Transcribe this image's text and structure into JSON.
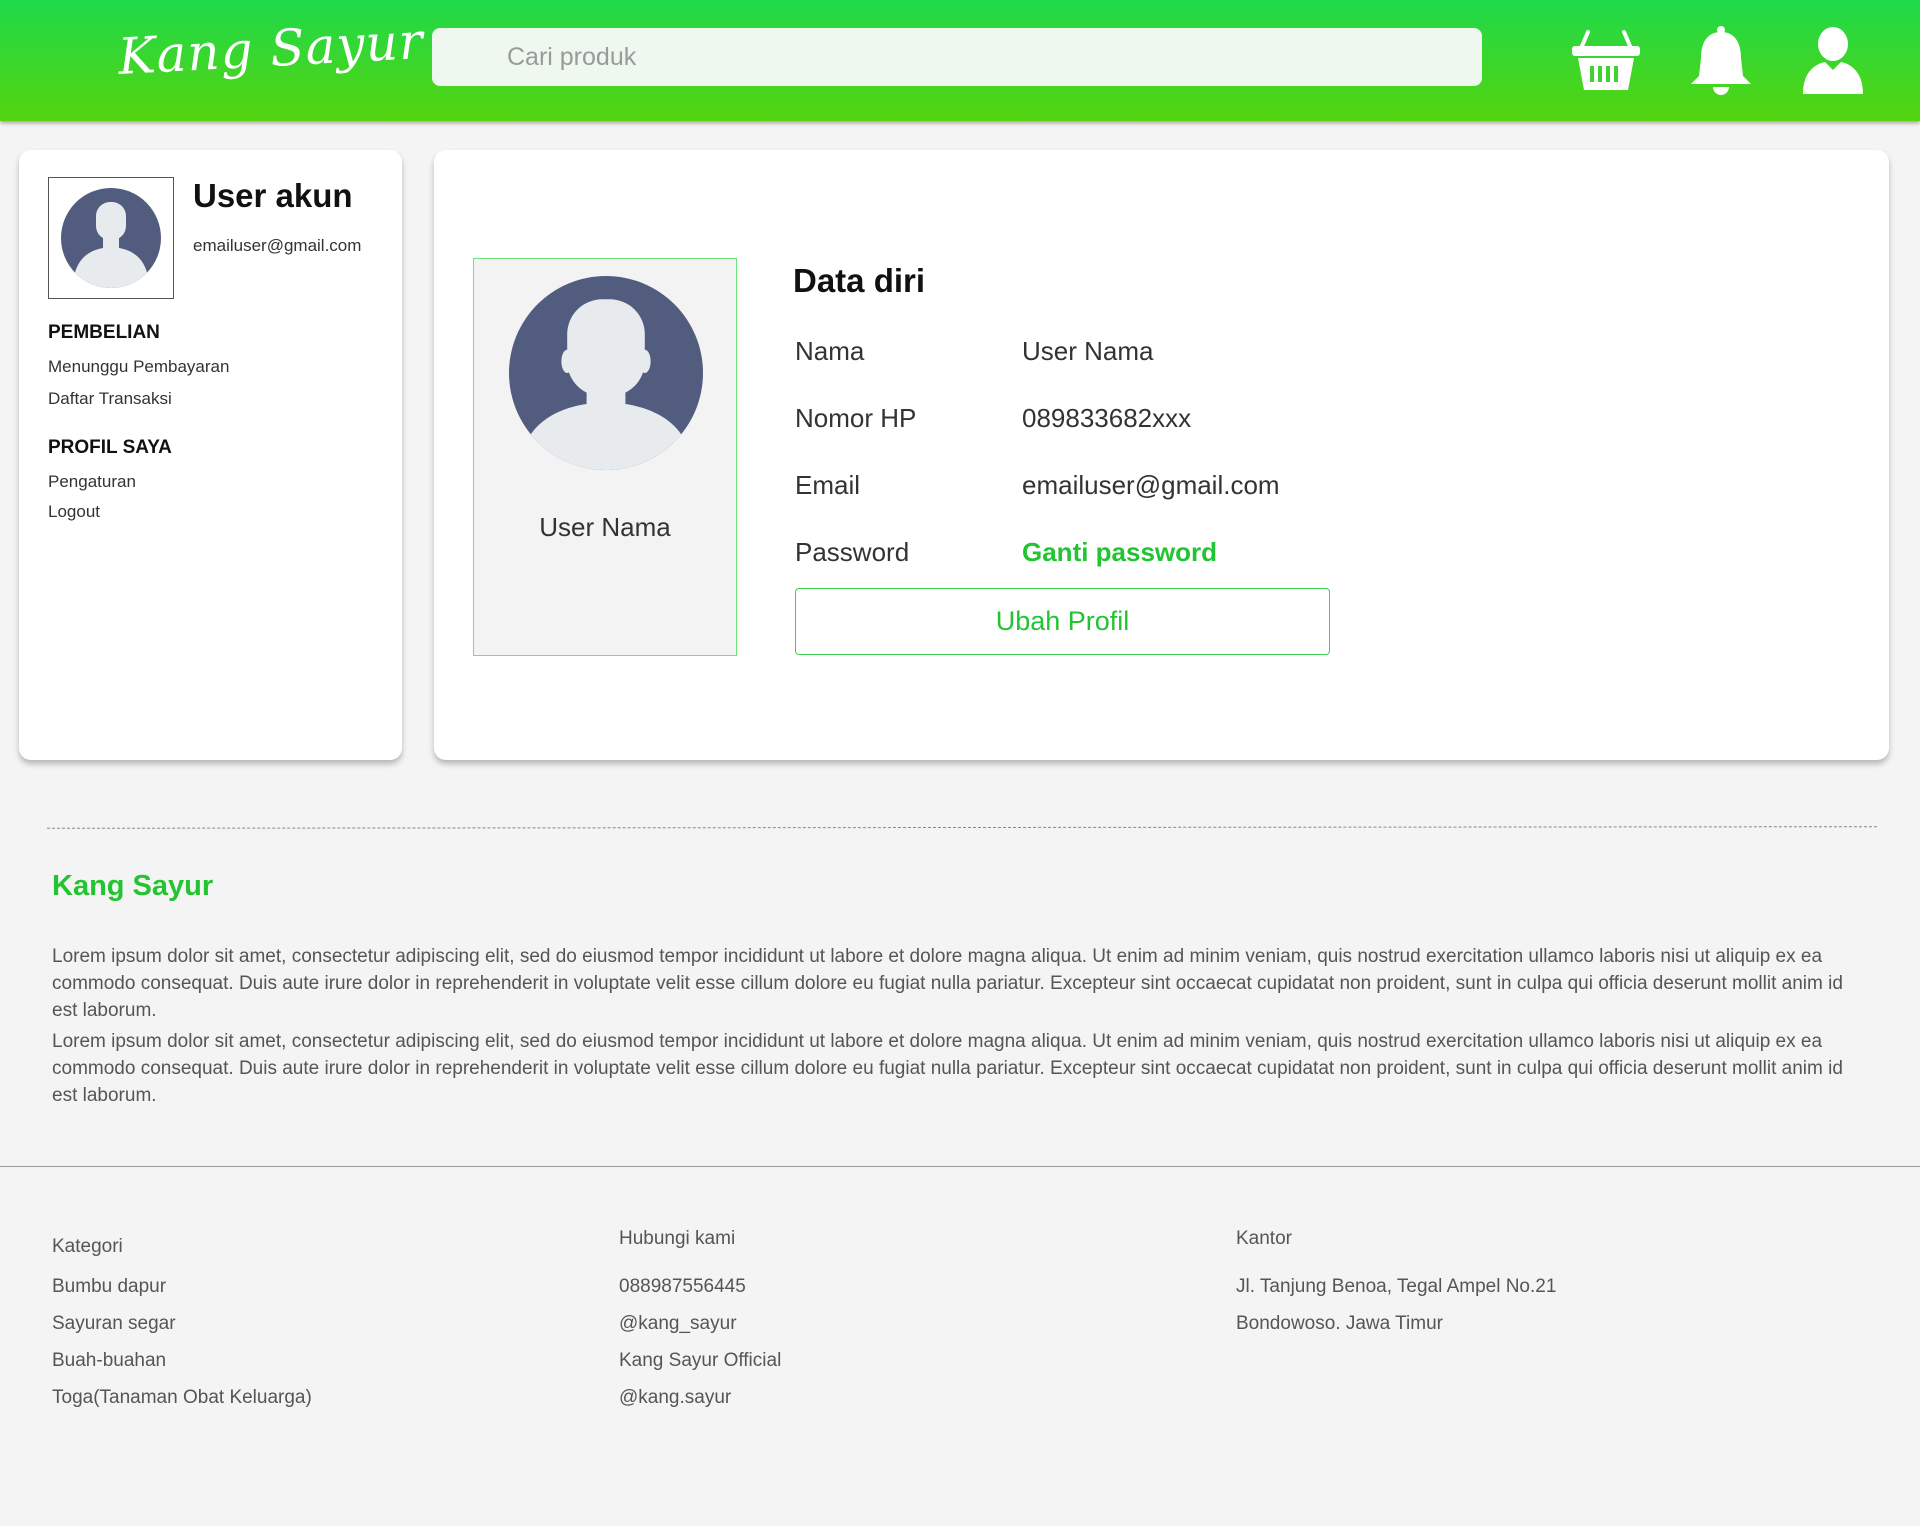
{
  "header": {
    "logo": "Kang Sayur",
    "search_placeholder": "Cari produk",
    "icons": [
      "basket-icon",
      "bell-icon",
      "user-icon"
    ]
  },
  "sidebar": {
    "name": "User akun",
    "email": "emailuser@gmail.com",
    "sections": [
      {
        "title": "PEMBELIAN",
        "items": [
          "Menunggu Pembayaran",
          "Daftar Transaksi"
        ]
      },
      {
        "title": "PROFIL SAYA",
        "items": [
          "Pengaturan",
          "Logout"
        ]
      }
    ]
  },
  "profile": {
    "photo_name": "User Nama",
    "title": "Data diri",
    "rows": [
      {
        "label": "Nama",
        "value": "User Nama"
      },
      {
        "label": "Nomor HP",
        "value": "089833682xxx"
      },
      {
        "label": "Email",
        "value": "emailuser@gmail.com"
      },
      {
        "label": "Password",
        "value": "Ganti password"
      }
    ],
    "edit_button": "Ubah Profil"
  },
  "about": {
    "title": "Kang Sayur",
    "paragraphs": [
      "Lorem ipsum dolor sit amet, consectetur adipiscing elit, sed do eiusmod tempor incididunt ut labore et dolore magna aliqua. Ut enim ad minim veniam, quis nostrud exercitation ullamco laboris nisi ut aliquip ex ea commodo consequat. Duis aute irure dolor in reprehenderit in voluptate velit esse cillum dolore eu fugiat nulla pariatur. Excepteur sint occaecat cupidatat non proident, sunt in culpa qui officia deserunt mollit anim id est laborum.",
      "Lorem ipsum dolor sit amet, consectetur adipiscing elit, sed do eiusmod tempor incididunt ut labore et dolore magna aliqua. Ut enim ad minim veniam, quis nostrud exercitation ullamco laboris nisi ut aliquip ex ea commodo consequat. Duis aute irure dolor in reprehenderit in voluptate velit esse cillum dolore eu fugiat nulla pariatur. Excepteur sint occaecat cupidatat non proident, sunt in culpa qui officia deserunt mollit anim id est laborum."
    ]
  },
  "footer": {
    "kategori": {
      "title": "Kategori",
      "items": [
        "Bumbu dapur",
        "Sayuran segar",
        "Buah-buahan",
        "Toga(Tanaman Obat Keluarga)"
      ]
    },
    "kontak": {
      "title": "Hubungi kami",
      "items": [
        "088987556445",
        "@kang_sayur",
        "Kang Sayur Official",
        "@kang.sayur"
      ]
    },
    "kantor": {
      "title": "Kantor",
      "items": [
        "Jl. Tanjung Benoa, Tegal Ampel No.21",
        "Bondowoso. Jawa Timur"
      ]
    }
  },
  "colors": {
    "header_top": "#1fd94a",
    "header_bottom": "#55d40f",
    "accent": "#22c432",
    "avatar": "#525c7e"
  }
}
